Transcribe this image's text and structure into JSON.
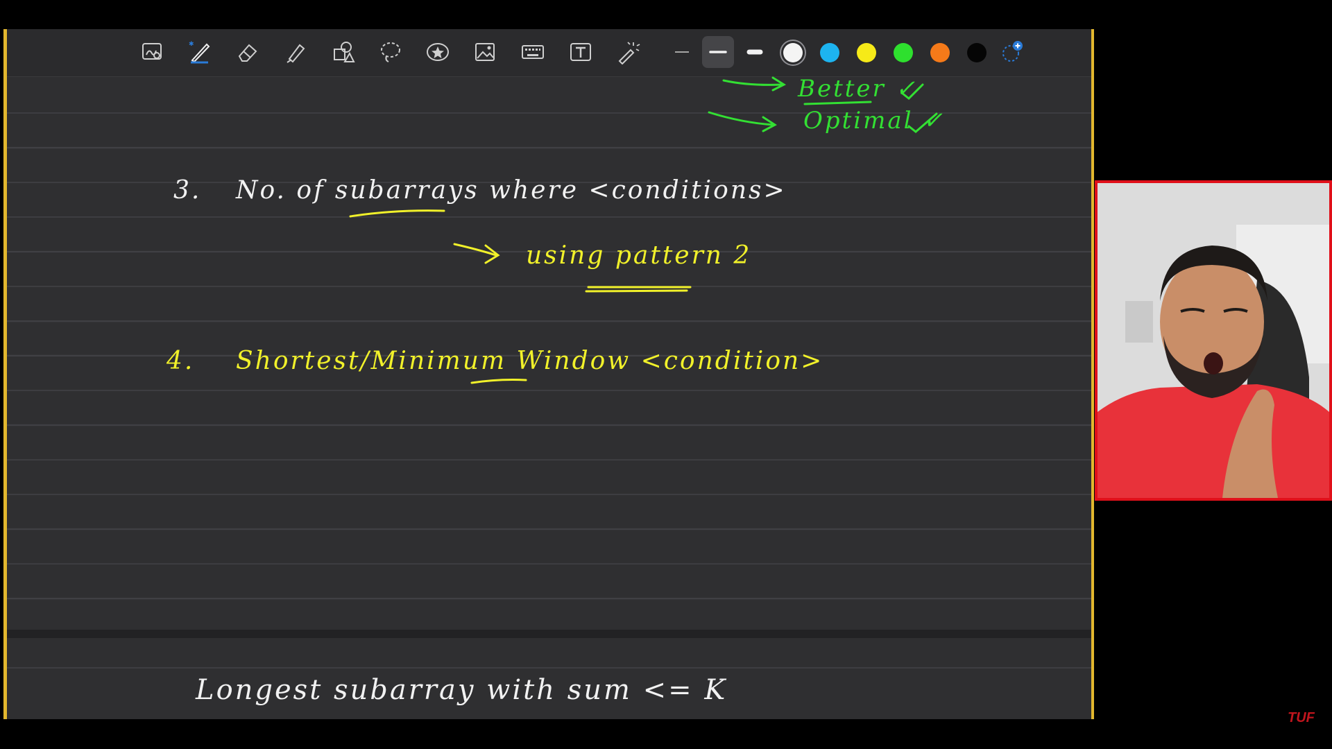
{
  "toolbar": {
    "tools": [
      {
        "name": "zoom-box-tool",
        "icon": "zoom-box-icon"
      },
      {
        "name": "pen-tool",
        "icon": "pen-icon",
        "selected": true
      },
      {
        "name": "eraser-tool",
        "icon": "eraser-icon"
      },
      {
        "name": "highlighter-tool",
        "icon": "highlighter-icon"
      },
      {
        "name": "shapes-tool",
        "icon": "shapes-icon"
      },
      {
        "name": "lasso-tool",
        "icon": "lasso-icon"
      },
      {
        "name": "sticker-tool",
        "icon": "star-sticker-icon"
      },
      {
        "name": "image-tool",
        "icon": "image-icon"
      },
      {
        "name": "keyboard-tool",
        "icon": "keyboard-icon"
      },
      {
        "name": "text-tool",
        "icon": "text-box-icon"
      },
      {
        "name": "laser-pointer-tool",
        "icon": "laser-pointer-icon"
      }
    ],
    "stroke_widths": [
      "thin",
      "medium",
      "thick"
    ],
    "selected_stroke": "medium",
    "colors": [
      "#f4f4f4",
      "#1db4f0",
      "#f6ea18",
      "#2ee02e",
      "#f57a19",
      "#050505"
    ],
    "selected_color": "#f4f4f4",
    "add_color_icon": "add-color-icon"
  },
  "notes": {
    "better": "Better ✓",
    "optimal": "Optimal ✓",
    "item3_number": "3.",
    "item3_text": "No. of subarrays where <conditions>",
    "item3_sub": "using pattern 2",
    "item4_number": "4.",
    "item4_text": "Shortest/Minimum Window <condition>",
    "page2_text": "Longest subarray with sum <= K"
  },
  "ink_colors": {
    "yellow": "#f1f12a",
    "green": "#33e033",
    "white": "#f2f2f2"
  },
  "watermark": "TUF"
}
